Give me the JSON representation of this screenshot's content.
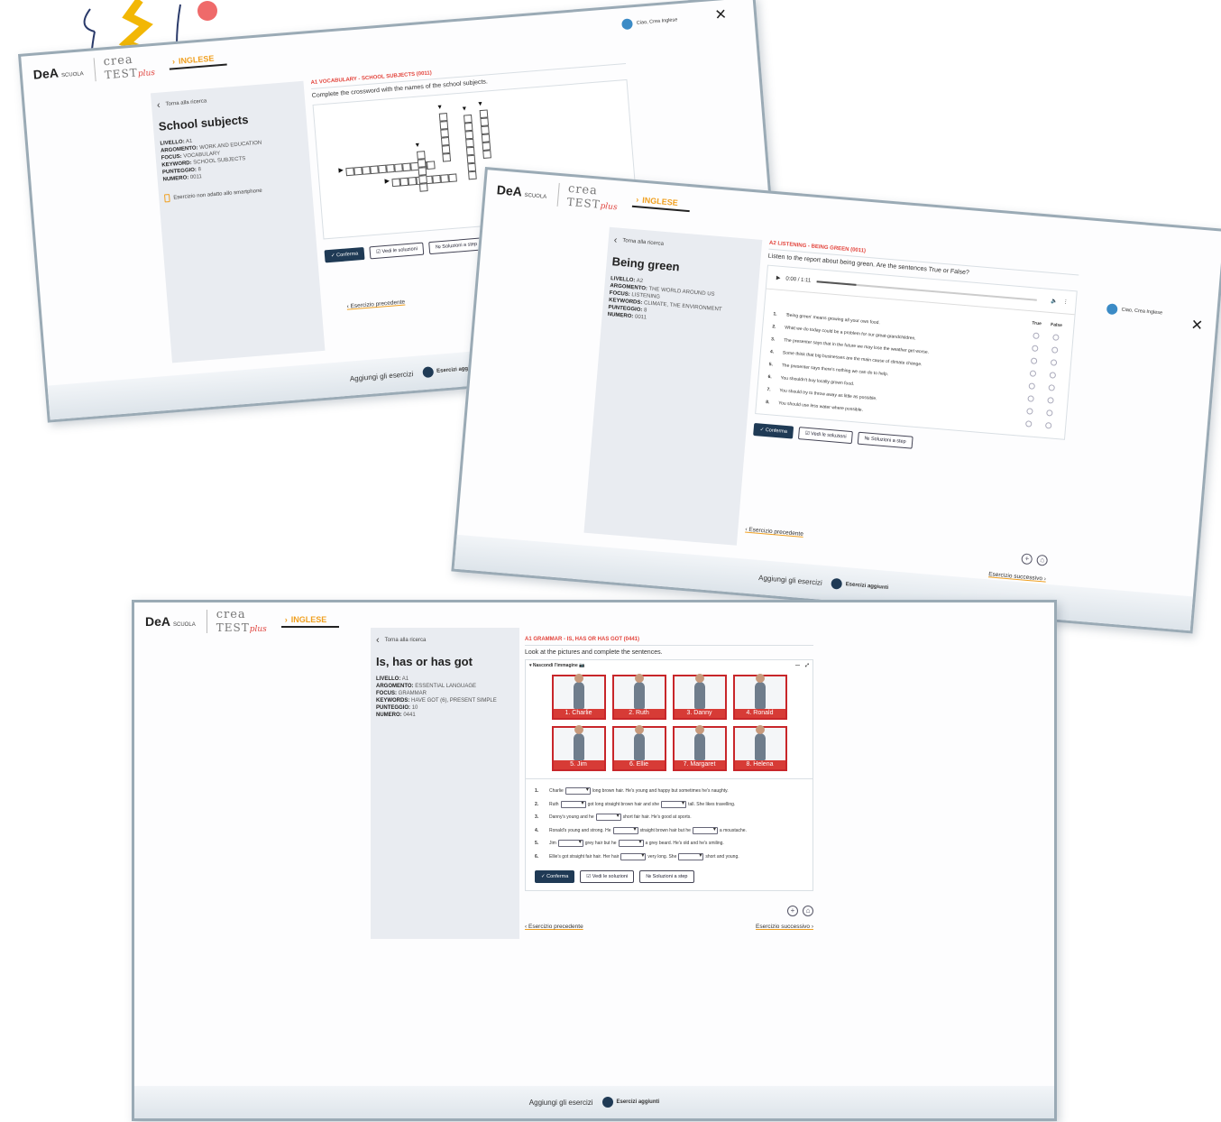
{
  "brand": {
    "dea": "DeA",
    "dea_sub": "SCUOLA",
    "crea1": "crea",
    "crea2": "TEST",
    "plus": "plus",
    "subject": "INGLESE"
  },
  "common": {
    "back": "Torna alla ricerca",
    "confirm": "Conferma",
    "see_solutions": "Vedi le soluzioni",
    "solutions_step": "Soluzioni a step",
    "prev": "Esercizio precedente",
    "next": "Esercizio successivo",
    "add_exercises": "Aggiungi gli esercizi",
    "added_exercises": "Esercizi aggiunti",
    "user": "Ciao, Crea Inglese"
  },
  "meta_labels": {
    "level": "LIVELLO:",
    "topic": "ARGOMENTO:",
    "focus": "FOCUS:",
    "keyword": "KEYWORD:",
    "keywords": "KEYWORDS:",
    "score": "PUNTEGGIO:",
    "number": "NUMERO:"
  },
  "shot1": {
    "title": "School subjects",
    "level": "A1",
    "topic": "WORK AND EDUCATION",
    "focus": "VOCABULARY",
    "keyword": "SCHOOL SUBJECTS",
    "score": "8",
    "number": "0011",
    "warning": "Esercizio non adatto allo smartphone",
    "code": "A1 VOCABULARY - SCHOOL SUBJECTS (0011)",
    "instruction": "Complete the crossword with the names of the school subjects."
  },
  "shot2": {
    "title": "Being green",
    "level": "A2",
    "topic": "THE WORLD AROUND US",
    "focus": "LISTENING",
    "keywords": "CLIMATE, THE ENVIRONMENT",
    "score": "8",
    "number": "0011",
    "code": "A2 LISTENING - BEING GREEN (0011)",
    "instruction": "Listen to the report about being green. Are the sentences True or False?",
    "time": "0:00 / 1:11",
    "true_label": "True",
    "false_label": "False",
    "sentences": [
      "'Being green' means growing all your own food.",
      "What we do today could be a problem for our great-grandchildren.",
      "The presenter says that in the future we may lose the weather get worse.",
      "Some think that big businesses are the main cause of climate change.",
      "The presenter says there's nothing we can do to help.",
      "You shouldn't buy locally grown food.",
      "You should try to throw away as little as possible.",
      "You should use less water where possible."
    ]
  },
  "shot3": {
    "title": "Is, has or has got",
    "level": "A1",
    "topic": "ESSENTIAL LANGUAGE",
    "focus": "GRAMMAR",
    "keywords": "HAVE GOT (6), PRESENT SIMPLE",
    "score": "10",
    "number": "0441",
    "code": "A1 GRAMMAR - IS, HAS OR HAS GOT (0441)",
    "instruction": "Look at the pictures and complete the sentences.",
    "hide_image": "Nascondi l'immagine",
    "people": [
      "1. Charlie",
      "2. Ruth",
      "3. Danny",
      "4. Ronald",
      "5. Jim",
      "6. Ellie",
      "7. Margaret",
      "8. Helena"
    ],
    "sentences": [
      {
        "a": "Charlie",
        "b": "long brown hair. He's young and happy but sometimes he's naughty."
      },
      {
        "a": "Ruth",
        "b": "got long straight brown hair and she",
        "c": "tall. She likes travelling."
      },
      {
        "a": "Danny's young and he",
        "b": "short fair hair. He's good at sports."
      },
      {
        "a": "Ronald's young and strong. He",
        "b": "straight brown hair but he",
        "c": "a moustache."
      },
      {
        "a": "Jim",
        "b": "grey hair but he",
        "c": "a grey beard. He's old and he's smiling."
      },
      {
        "a": "Ellie's got straight fair hair. Her hair",
        "b": "very long. She",
        "c": "short and young."
      }
    ]
  }
}
